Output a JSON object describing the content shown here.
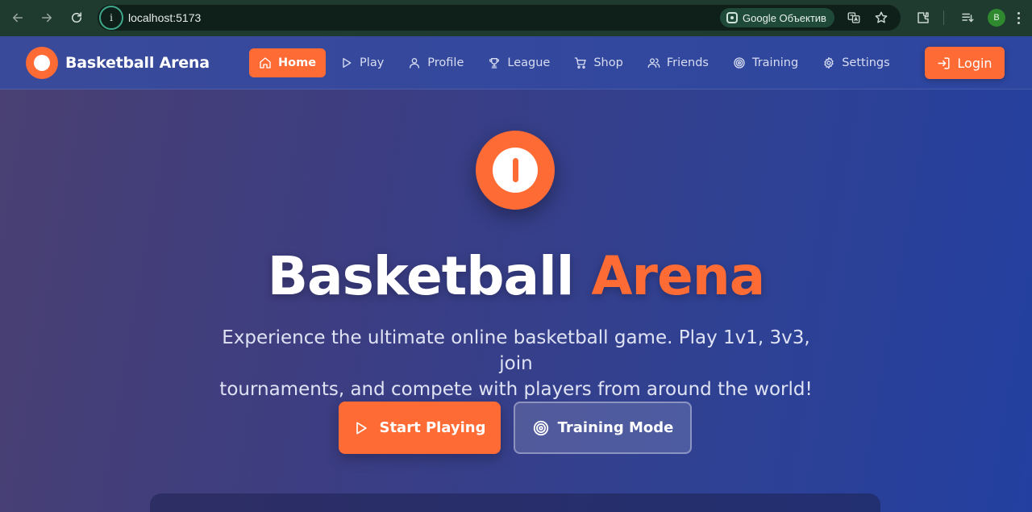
{
  "browser": {
    "url": "localhost:5173",
    "lens_label": "Google Объектив",
    "profile_initial": "B",
    "icons": [
      "back-arrow-icon",
      "forward-arrow-icon",
      "reload-icon",
      "site-info-icon",
      "google-lens-icon",
      "translate-icon",
      "bookmark-star-icon",
      "extensions-icon",
      "reading-list-icon",
      "profile-avatar",
      "menu-icon"
    ]
  },
  "nav": {
    "brand": "Basketball Arena",
    "links": [
      {
        "label": "Home",
        "icon": "home-icon",
        "active": true
      },
      {
        "label": "Play",
        "icon": "play-icon"
      },
      {
        "label": "Profile",
        "icon": "user-icon"
      },
      {
        "label": "League",
        "icon": "trophy-icon"
      },
      {
        "label": "Shop",
        "icon": "cart-icon"
      },
      {
        "label": "Friends",
        "icon": "users-icon"
      },
      {
        "label": "Training",
        "icon": "target-icon"
      },
      {
        "label": "Settings",
        "icon": "gear-icon"
      }
    ],
    "login": "Login"
  },
  "hero": {
    "title_main": "Basketball",
    "title_accent": "Arena",
    "subtitle_line1": "Experience the ultimate online basketball game. Play 1v1, 3v3, join",
    "subtitle_line2": "tournaments, and compete with players from around the world!",
    "primary_cta": "Start Playing",
    "secondary_cta": "Training Mode"
  },
  "colors": {
    "accent": "#ff6b35",
    "nav_bg": "#2d46a0",
    "hero_bg_start": "#4a4072",
    "hero_bg_end": "#2340a0"
  }
}
